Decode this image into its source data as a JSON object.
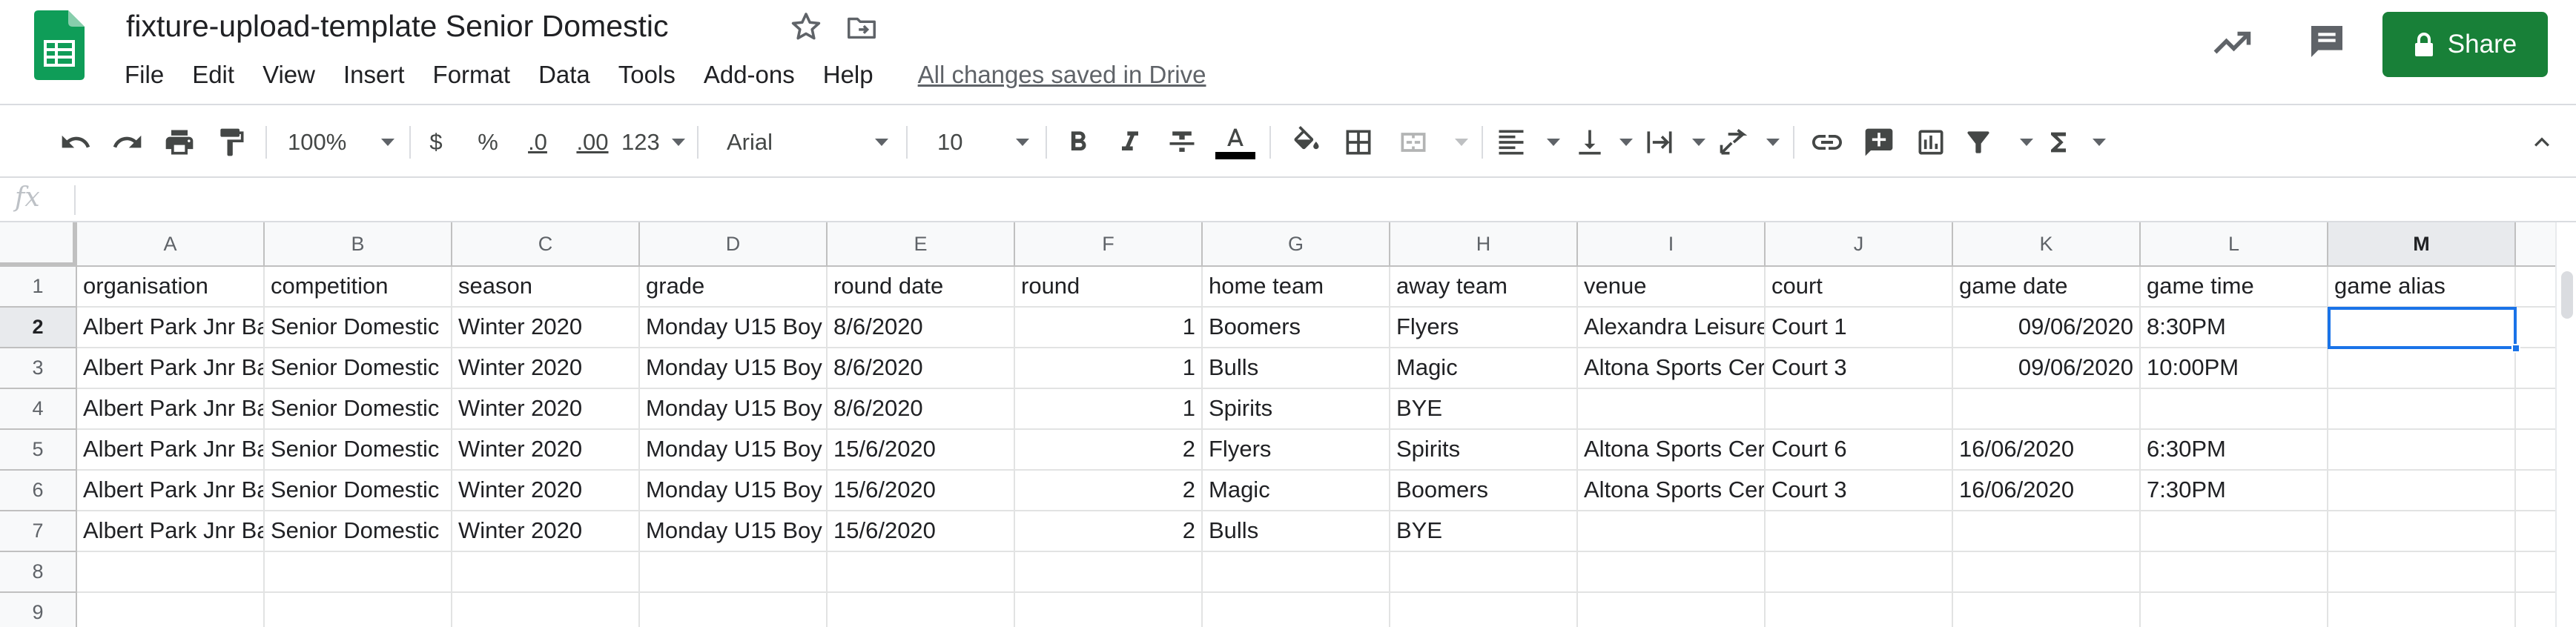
{
  "app": {
    "title": "fixture-upload-template Senior Domestic",
    "save_status": "All changes saved in Drive",
    "share_label": "Share",
    "brand_color": "#188038",
    "icons": [
      "sheets-logo",
      "star-icon",
      "move-to-folder-icon",
      "activity-trend-icon",
      "comment-icon",
      "lock-icon"
    ]
  },
  "menu": [
    "File",
    "Edit",
    "View",
    "Insert",
    "Format",
    "Data",
    "Tools",
    "Add-ons",
    "Help"
  ],
  "toolbar": {
    "zoom": "100%",
    "currency": "$",
    "percent": "%",
    "decrease_decimal": ".0",
    "increase_decimal": ".00",
    "more_formats": "123",
    "font": "Arial",
    "font_size": "10",
    "text_color": "#000000",
    "icons": [
      "undo-icon",
      "redo-icon",
      "print-icon",
      "paint-format-icon",
      "bold-icon",
      "italic-icon",
      "strikethrough-icon",
      "text-color-icon",
      "fill-color-icon",
      "borders-icon",
      "merge-cells-icon",
      "horizontal-align-icon",
      "vertical-align-icon",
      "text-wrapping-icon",
      "text-rotation-icon",
      "insert-link-icon",
      "insert-comment-icon",
      "insert-chart-icon",
      "filter-icon",
      "functions-icon",
      "collapse-toolbar-icon"
    ]
  },
  "formula_bar": {
    "label": "fx",
    "value": ""
  },
  "sheet": {
    "columns": [
      "A",
      "B",
      "C",
      "D",
      "E",
      "F",
      "G",
      "H",
      "I",
      "J",
      "K",
      "L",
      "M"
    ],
    "selected_column": "M",
    "selected_row": "2",
    "row_numbers": [
      "1",
      "2",
      "3",
      "4",
      "5",
      "6",
      "7",
      "8",
      "9"
    ],
    "rows": [
      [
        "organisation",
        "competition",
        "season",
        "grade",
        "round date",
        "round",
        "home team",
        "away team",
        "venue",
        "court",
        "game date",
        "game time",
        "game alias"
      ],
      [
        "Albert Park Jnr Ba",
        "Senior Domestic",
        "Winter 2020",
        "Monday U15 Boy",
        "8/6/2020",
        "1",
        "Boomers",
        "Flyers",
        "Alexandra Leisure",
        "Court 1",
        "09/06/2020",
        "8:30PM",
        ""
      ],
      [
        "Albert Park Jnr Ba",
        "Senior Domestic",
        "Winter 2020",
        "Monday U15 Boy",
        "8/6/2020",
        "1",
        "Bulls",
        "Magic",
        "Altona Sports Cer",
        "Court 3",
        "09/06/2020",
        "10:00PM",
        ""
      ],
      [
        "Albert Park Jnr Ba",
        "Senior Domestic",
        "Winter 2020",
        "Monday U15 Boy",
        "8/6/2020",
        "1",
        "Spirits",
        "BYE",
        "",
        "",
        "",
        "",
        ""
      ],
      [
        "Albert Park Jnr Ba",
        "Senior Domestic",
        "Winter 2020",
        "Monday U15 Boy",
        "15/6/2020",
        "2",
        "Flyers",
        "Spirits",
        "Altona Sports Cer",
        "Court 6",
        "16/06/2020",
        "6:30PM",
        ""
      ],
      [
        "Albert Park Jnr Ba",
        "Senior Domestic",
        "Winter 2020",
        "Monday U15 Boy",
        "15/6/2020",
        "2",
        "Magic",
        "Boomers",
        "Altona Sports Cer",
        "Court 3",
        "16/06/2020",
        "7:30PM",
        ""
      ],
      [
        "Albert Park Jnr Ba",
        "Senior Domestic",
        "Winter 2020",
        "Monday U15 Boy",
        "15/6/2020",
        "2",
        "Bulls",
        "BYE",
        "",
        "",
        "",
        "",
        ""
      ],
      [
        "",
        "",
        "",
        "",
        "",
        "",
        "",
        "",
        "",
        "",
        "",
        "",
        ""
      ],
      [
        "",
        "",
        "",
        "",
        "",
        "",
        "",
        "",
        "",
        "",
        "",
        "",
        ""
      ]
    ],
    "right_aligned": [
      [
        1,
        5
      ],
      [
        1,
        10
      ],
      [
        2,
        5
      ],
      [
        2,
        10
      ],
      [
        3,
        5
      ],
      [
        4,
        5
      ],
      [
        5,
        5
      ],
      [
        6,
        5
      ]
    ]
  }
}
